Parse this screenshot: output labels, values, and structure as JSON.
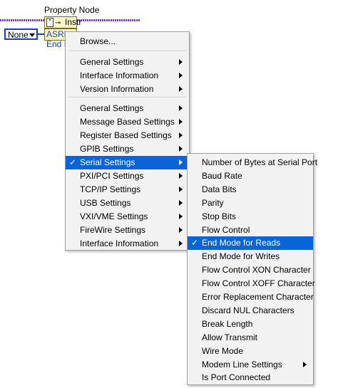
{
  "block": {
    "title": "Property Node",
    "reference_label": "Instr",
    "property_label": "ASRL End I...",
    "control_value": "None"
  },
  "main_menu": {
    "items": [
      {
        "label": "Browse...",
        "submenu": false
      },
      {
        "label": "General Settings",
        "submenu": true
      },
      {
        "label": "Interface Information",
        "submenu": true
      },
      {
        "label": "Version Information",
        "submenu": true
      },
      {
        "label": "General Settings",
        "submenu": true
      },
      {
        "label": "Message Based Settings",
        "submenu": true
      },
      {
        "label": "Register Based Settings",
        "submenu": true
      },
      {
        "label": "GPIB Settings",
        "submenu": true
      },
      {
        "label": "Serial Settings",
        "submenu": true,
        "selected": true
      },
      {
        "label": "PXI/PCI Settings",
        "submenu": true
      },
      {
        "label": "TCP/IP Settings",
        "submenu": true
      },
      {
        "label": "USB Settings",
        "submenu": true
      },
      {
        "label": "VXI/VME Settings",
        "submenu": true
      },
      {
        "label": "FireWire Settings",
        "submenu": true
      },
      {
        "label": "Interface Information",
        "submenu": true
      }
    ]
  },
  "serial_menu": {
    "items": [
      {
        "label": "Number of Bytes at Serial Port"
      },
      {
        "label": "Baud Rate"
      },
      {
        "label": "Data Bits"
      },
      {
        "label": "Parity"
      },
      {
        "label": "Stop Bits"
      },
      {
        "label": "Flow Control"
      },
      {
        "label": "End Mode for Reads",
        "selected": true
      },
      {
        "label": "End Mode for Writes"
      },
      {
        "label": "Flow Control XON Character"
      },
      {
        "label": "Flow Control XOFF Character"
      },
      {
        "label": "Error Replacement Character"
      },
      {
        "label": "Discard NUL Characters"
      },
      {
        "label": "Break Length"
      },
      {
        "label": "Allow Transmit"
      },
      {
        "label": "Wire Mode"
      },
      {
        "label": "Modem Line Settings",
        "submenu": true
      },
      {
        "label": "Is Port Connected"
      }
    ]
  },
  "check_mark": "✓",
  "colors": {
    "highlight": "#0a64d6",
    "wire_blue": "#1e3cc8",
    "wire_purple": "#8a2be2"
  }
}
